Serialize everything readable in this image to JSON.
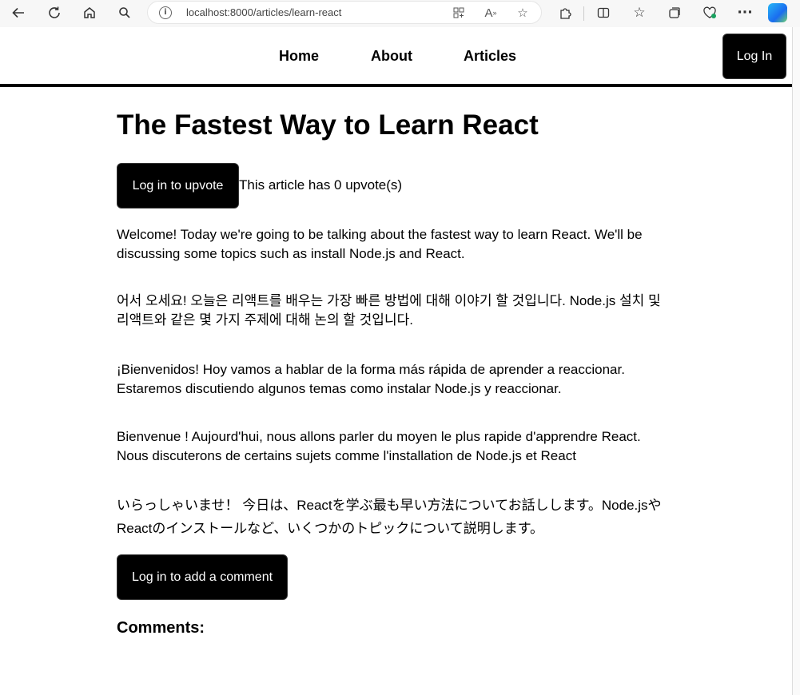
{
  "browser": {
    "url": "localhost:8000/articles/learn-react",
    "icons": [
      "back-icon",
      "refresh-icon",
      "home-icon",
      "search-icon",
      "site-info-icon",
      "apps-icon",
      "read-aloud-icon",
      "favorite-star-icon",
      "extensions-icon",
      "split-screen-icon",
      "favorites-icon",
      "collections-icon",
      "browser-essentials-icon",
      "more-icon",
      "copilot-icon"
    ]
  },
  "nav": {
    "links": [
      "Home",
      "About",
      "Articles"
    ],
    "login_label": "Log In"
  },
  "article": {
    "title": "The Fastest Way to Learn React",
    "upvote_button": "Log in to upvote",
    "upvote_text": "This article has 0 upvote(s)",
    "paragraphs": [
      "Welcome! Today we're going to be talking about the fastest way to learn React. We'll be discussing some topics such as install Node.js and React.",
      "어서 오세요! 오늘은 리액트를 배우는 가장 빠른 방법에 대해 이야기 할 것입니다. Node.js 설치 및 리액트와 같은 몇 가지 주제에 대해 논의 할 것입니다.",
      "¡Bienvenidos! Hoy vamos a hablar de la forma más rápida de aprender a reaccionar. Estaremos discutiendo algunos temas como instalar Node.js y reaccionar.",
      "Bienvenue ! Aujourd'hui, nous allons parler du moyen le plus rapide d'apprendre React. Nous discuterons de certains sujets comme l'installation de Node.js et React",
      "いらっしゃいませ！ 今日は、Reactを学ぶ最も早い方法についてお話しします。Node.jsやReactのインストールなど、いくつかのトピックについて説明します。"
    ],
    "comment_button": "Log in to add a comment",
    "comments_heading": "Comments:"
  }
}
